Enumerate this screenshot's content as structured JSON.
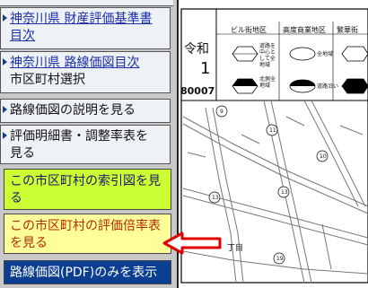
{
  "sidebar": {
    "items": [
      {
        "link": "神奈川県 財産評価基準書",
        "link2": "目次"
      },
      {
        "link": "神奈川県 路線価図目次",
        "sub": "市区町村選択"
      },
      {
        "label": "路線価図の説明を見る"
      },
      {
        "label": "評価明細書・調整率表を",
        "label2": "見る"
      }
    ],
    "actions": {
      "index_map": "この市区町村の索引図を見る",
      "multiplier_table": "この市区町村の評価倍率表を見る",
      "pdf_only": "路線価図(PDF)のみを表示"
    }
  },
  "map": {
    "era": "令和",
    "year": "1",
    "code": "80007",
    "legend": {
      "building_district": "ビル街地区",
      "high_commercial": "高度商業地区",
      "busy_street": "繁華街",
      "center_note": "道路を中心として全地域",
      "whole_area": "全地域",
      "north_note": "北側全地域",
      "along_road": "道路沿い"
    },
    "block_numbers": [
      "9",
      "11",
      "10",
      "13",
      "13",
      "19"
    ],
    "chome": "丁目"
  },
  "colors": {
    "index_bg": "#ccff33",
    "multiplier_bg": "#ffff99",
    "multiplier_text": "#b52a00",
    "pdf_bg": "#0b3d91",
    "arrow": "#e00000"
  }
}
